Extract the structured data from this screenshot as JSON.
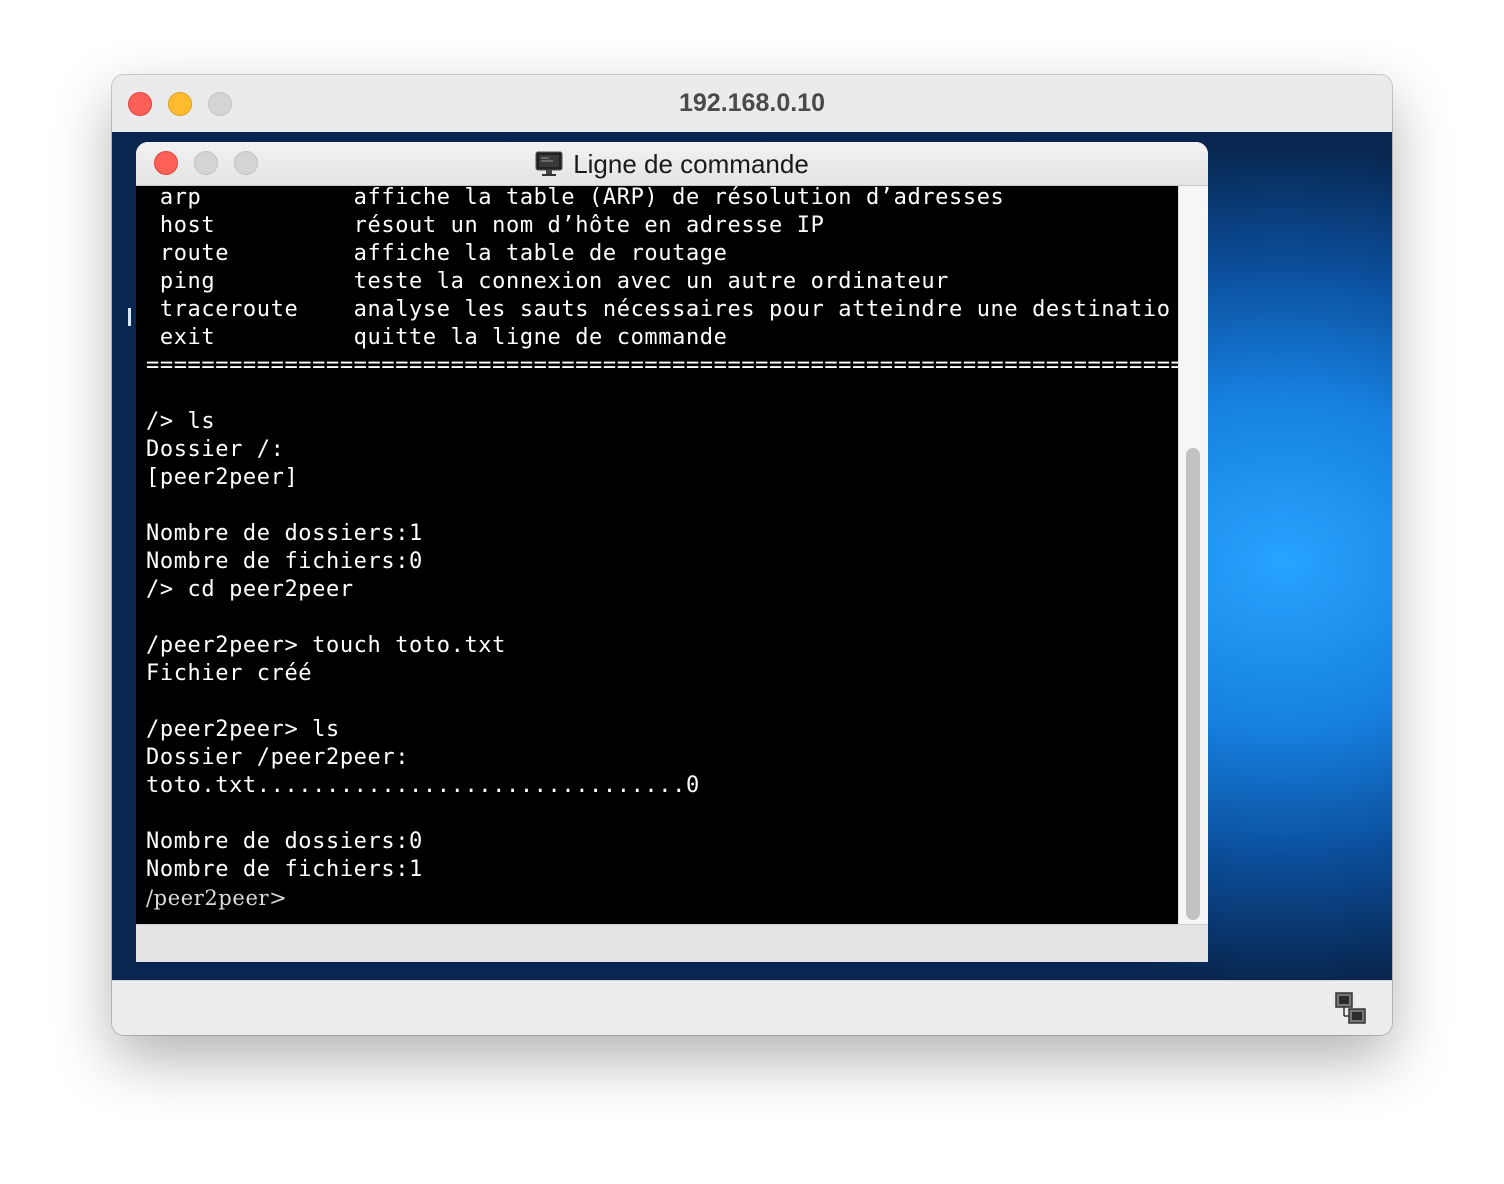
{
  "outer_window": {
    "title": "192.168.0.10"
  },
  "inner_window": {
    "title": "Ligne de commande",
    "title_icon": "monitor-icon"
  },
  "terminal": {
    "lines": [
      " arp           affiche la table (ARP) de résolution d’adresses",
      " host          résout un nom d’hôte en adresse IP",
      " route         affiche la table de routage",
      " ping          teste la connexion avec un autre ordinateur",
      " traceroute    analyse les sauts nécessaires pour atteindre une destinatio",
      " exit          quitte la ligne de commande",
      "======================================================================================",
      "",
      "/> ls",
      "Dossier /:",
      "[peer2peer]",
      "",
      "Nombre de dossiers:1",
      "Nombre de fichiers:0",
      "/> cd peer2peer",
      "",
      "/peer2peer> touch toto.txt",
      "Fichier créé",
      "",
      "/peer2peer> ls",
      "Dossier /peer2peer:",
      "toto.txt...............................0",
      "",
      "Nombre de dossiers:0",
      "Nombre de fichiers:1"
    ],
    "prompt": "/peer2peer>"
  },
  "status_bar": {
    "icon": "network-icon"
  },
  "colors": {
    "terminal_bg": "#000000",
    "terminal_fg": "#ffffff",
    "close": "#fe5f57",
    "minimize": "#febc2e",
    "desktop_accent": "#1a8ff0"
  }
}
